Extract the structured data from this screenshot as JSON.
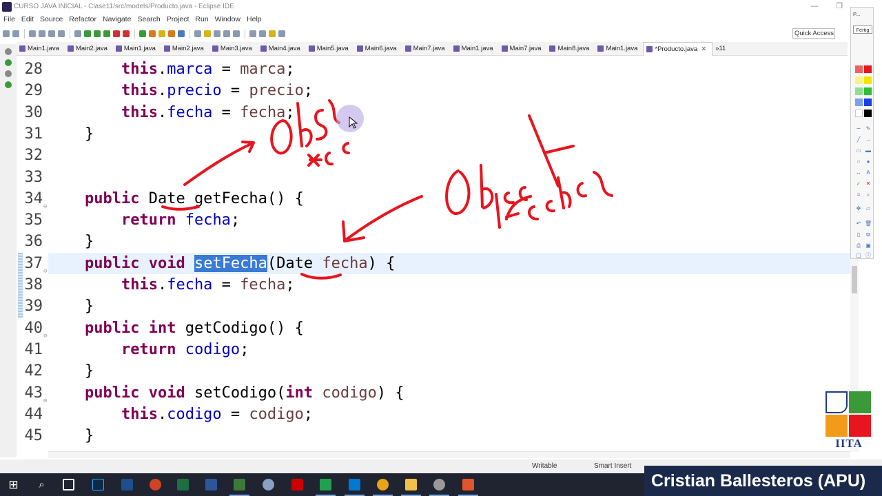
{
  "window": {
    "title": "CURSO JAVA INICIAL - Clase11/src/models/Producto.java - Eclipse IDE",
    "controls": {
      "minimize": "—",
      "restore": "❐",
      "close": "✕"
    }
  },
  "menu": [
    "File",
    "Edit",
    "Source",
    "Refactor",
    "Navigate",
    "Search",
    "Project",
    "Run",
    "Window",
    "Help"
  ],
  "toolbar": {
    "quick_access": "Quick Access"
  },
  "tabs": [
    {
      "label": "Main1.java"
    },
    {
      "label": "Main2.java"
    },
    {
      "label": "Main1.java"
    },
    {
      "label": "Main2.java"
    },
    {
      "label": "Main3.java"
    },
    {
      "label": "Main4.java"
    },
    {
      "label": "Main5.java"
    },
    {
      "label": "Main6.java"
    },
    {
      "label": "Main7.java"
    },
    {
      "label": "Main1.java"
    },
    {
      "label": "Main7.java"
    },
    {
      "label": "Main8.java"
    },
    {
      "label": "Main1.java"
    },
    {
      "label": "*Producto.java",
      "active": true
    }
  ],
  "tabs_overflow": "»11",
  "editor": {
    "current_line": 37,
    "lines": [
      {
        "n": "28",
        "tokens": [
          [
            "",
            "        "
          ],
          [
            "kw",
            "this"
          ],
          [
            "",
            "."
          ],
          [
            "fld",
            "marca"
          ],
          [
            "",
            " = "
          ],
          [
            "loc",
            "marca"
          ],
          [
            "",
            ";"
          ]
        ]
      },
      {
        "n": "29",
        "tokens": [
          [
            "",
            "        "
          ],
          [
            "kw",
            "this"
          ],
          [
            "",
            "."
          ],
          [
            "fld",
            "precio"
          ],
          [
            "",
            " = "
          ],
          [
            "loc",
            "precio"
          ],
          [
            "",
            ";"
          ]
        ]
      },
      {
        "n": "30",
        "tokens": [
          [
            "",
            "        "
          ],
          [
            "kw",
            "this"
          ],
          [
            "",
            "."
          ],
          [
            "fld",
            "fecha"
          ],
          [
            "",
            " = "
          ],
          [
            "loc",
            "fecha"
          ],
          [
            "",
            ";"
          ]
        ]
      },
      {
        "n": "31",
        "tokens": [
          [
            "",
            "    }"
          ]
        ]
      },
      {
        "n": "32",
        "tokens": []
      },
      {
        "n": "33",
        "tokens": []
      },
      {
        "n": "34",
        "fold": true,
        "tokens": [
          [
            "",
            "    "
          ],
          [
            "kw",
            "public"
          ],
          [
            "",
            " Date getFecha() {"
          ]
        ]
      },
      {
        "n": "35",
        "tokens": [
          [
            "",
            "        "
          ],
          [
            "kw",
            "return"
          ],
          [
            "",
            " "
          ],
          [
            "fld",
            "fecha"
          ],
          [
            "",
            ";"
          ]
        ]
      },
      {
        "n": "36",
        "tokens": [
          [
            "",
            "    }"
          ]
        ]
      },
      {
        "n": "37",
        "fold": true,
        "tokens": [
          [
            "",
            "    "
          ],
          [
            "kw",
            "public"
          ],
          [
            "",
            " "
          ],
          [
            "kw",
            "void"
          ],
          [
            "",
            " "
          ],
          [
            "sel",
            "setFecha"
          ],
          [
            "",
            "(Date "
          ],
          [
            "loc",
            "fecha"
          ],
          [
            "",
            ") {"
          ]
        ]
      },
      {
        "n": "38",
        "tokens": [
          [
            "",
            "        "
          ],
          [
            "kw",
            "this"
          ],
          [
            "",
            "."
          ],
          [
            "fld",
            "fecha"
          ],
          [
            "",
            " = "
          ],
          [
            "loc",
            "fecha"
          ],
          [
            "",
            ";"
          ]
        ]
      },
      {
        "n": "39",
        "tokens": [
          [
            "",
            "    }"
          ]
        ]
      },
      {
        "n": "40",
        "fold": true,
        "tokens": [
          [
            "",
            "    "
          ],
          [
            "kw",
            "public"
          ],
          [
            "",
            " "
          ],
          [
            "kw",
            "int"
          ],
          [
            "",
            " getCodigo() {"
          ]
        ]
      },
      {
        "n": "41",
        "tokens": [
          [
            "",
            "        "
          ],
          [
            "kw",
            "return"
          ],
          [
            "",
            " "
          ],
          [
            "fld",
            "codigo"
          ],
          [
            "",
            ";"
          ]
        ]
      },
      {
        "n": "42",
        "tokens": [
          [
            "",
            "    }"
          ]
        ]
      },
      {
        "n": "43",
        "fold": true,
        "tokens": [
          [
            "",
            "    "
          ],
          [
            "kw",
            "public"
          ],
          [
            "",
            " "
          ],
          [
            "kw",
            "void"
          ],
          [
            "",
            " setCodigo("
          ],
          [
            "kw",
            "int"
          ],
          [
            "",
            " "
          ],
          [
            "loc",
            "codigo"
          ],
          [
            "",
            ") {"
          ]
        ]
      },
      {
        "n": "44",
        "tokens": [
          [
            "",
            "        "
          ],
          [
            "kw",
            "this"
          ],
          [
            "",
            "."
          ],
          [
            "fld",
            "codigo"
          ],
          [
            "",
            " = "
          ],
          [
            "loc",
            "codigo"
          ],
          [
            "",
            ";"
          ]
        ]
      },
      {
        "n": "45",
        "tokens": [
          [
            "",
            "    }"
          ]
        ]
      }
    ]
  },
  "status": {
    "writable": "Writable",
    "insert_mode": "Smart Insert"
  },
  "palette": {
    "top_label": "P...",
    "fertig": "Fertig"
  },
  "logo": {
    "caption": "IITA"
  },
  "presenter": "Cristian Ballesteros (APU)",
  "colors": {
    "keyword": "#7f0055",
    "field": "#0000c0",
    "local": "#6a3e3e",
    "selection": "#3a7bd5",
    "ink": "#e8141e",
    "banner": "#1b2a4a"
  }
}
